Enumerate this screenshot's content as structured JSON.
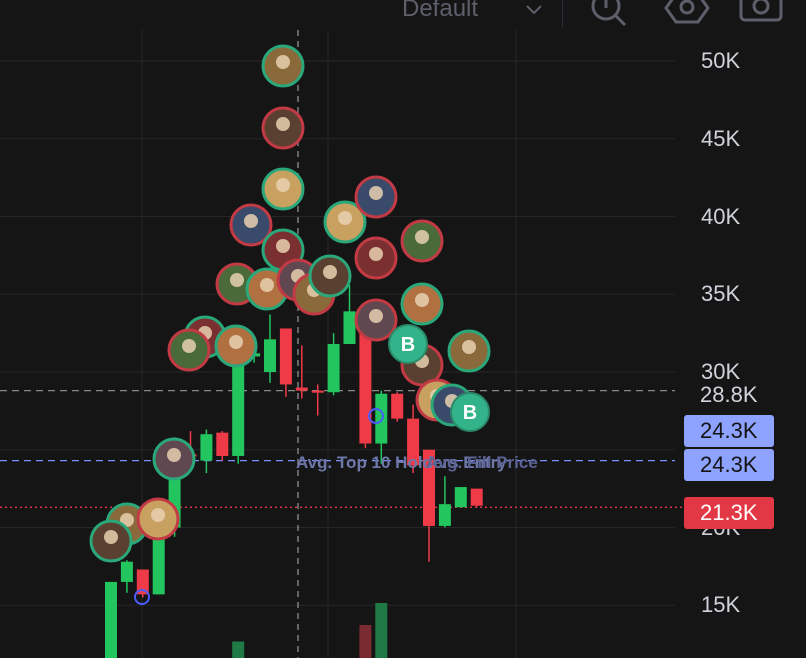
{
  "toolbar": {
    "preset_label": "Default"
  },
  "price_axis": {
    "ticks": [
      "50K",
      "45K",
      "40K",
      "35K",
      "30K",
      "20K",
      "15K"
    ],
    "tags": {
      "top_price": "28.8K",
      "avg_price_1": "24.3K",
      "avg_price_2": "24.3K",
      "current_price": "21.3K"
    }
  },
  "overlay": {
    "label_1": "Avg. Top 10 Holders Entry",
    "label_2": "Avg. Fill Price"
  },
  "markers": {
    "buy_badge": "B"
  },
  "colors": {
    "up": "#22c55e",
    "down": "#ef3b48",
    "avg_line": "#7d8fff",
    "current_line": "#e23845",
    "grid": "#262626"
  },
  "chart_data": {
    "type": "candlestick",
    "title": "",
    "ylabel": "",
    "ylim": [
      13000,
      52000
    ],
    "yticks": [
      15000,
      20000,
      25000,
      30000,
      35000,
      40000,
      45000,
      50000
    ],
    "reference_lines": [
      {
        "name": "top",
        "value": 28800,
        "style": "dashed"
      },
      {
        "name": "avg",
        "value": 24300,
        "style": "dashed"
      },
      {
        "name": "current",
        "value": 21300,
        "style": "dotted"
      }
    ],
    "candles": [
      {
        "o": 11000,
        "h": 16500,
        "l": 11000,
        "c": 16500
      },
      {
        "o": 16500,
        "h": 17900,
        "l": 15800,
        "c": 17800
      },
      {
        "o": 17300,
        "h": 17300,
        "l": 15500,
        "c": 15700
      },
      {
        "o": 15700,
        "h": 20000,
        "l": 15700,
        "c": 20000
      },
      {
        "o": 20000,
        "h": 25800,
        "l": 19400,
        "c": 25400
      },
      {
        "o": 24700,
        "h": 26200,
        "l": 24500,
        "c": 24600
      },
      {
        "o": 24300,
        "h": 26300,
        "l": 23500,
        "c": 26000
      },
      {
        "o": 26100,
        "h": 26200,
        "l": 24300,
        "c": 24600
      },
      {
        "o": 24600,
        "h": 31700,
        "l": 24100,
        "c": 31400
      },
      {
        "o": 31000,
        "h": 31600,
        "l": 30600,
        "c": 31200
      },
      {
        "o": 30000,
        "h": 33700,
        "l": 29300,
        "c": 32100
      },
      {
        "o": 32800,
        "h": 32800,
        "l": 28400,
        "c": 29200
      },
      {
        "o": 29000,
        "h": 31700,
        "l": 28300,
        "c": 28800
      },
      {
        "o": 28800,
        "h": 29200,
        "l": 27200,
        "c": 28700
      },
      {
        "o": 28700,
        "h": 32500,
        "l": 28500,
        "c": 31800
      },
      {
        "o": 31800,
        "h": 35600,
        "l": 31800,
        "c": 33900
      },
      {
        "o": 33900,
        "h": 34200,
        "l": 25100,
        "c": 25400
      },
      {
        "o": 25400,
        "h": 28800,
        "l": 24100,
        "c": 28600
      },
      {
        "o": 28600,
        "h": 28700,
        "l": 26800,
        "c": 27000
      },
      {
        "o": 27000,
        "h": 27900,
        "l": 23500,
        "c": 24000
      },
      {
        "o": 25000,
        "h": 25000,
        "l": 17800,
        "c": 20100
      },
      {
        "o": 20100,
        "h": 23300,
        "l": 20000,
        "c": 21500
      },
      {
        "o": 21300,
        "h": 22600,
        "l": 21300,
        "c": 22600
      },
      {
        "o": 22500,
        "h": 22500,
        "l": 21300,
        "c": 21400
      }
    ],
    "volume_relative": [
      0,
      0,
      0,
      0,
      0,
      0,
      0,
      0,
      0.3,
      0,
      0,
      0,
      0,
      0,
      0,
      0,
      0.6,
      1.0,
      0,
      0,
      0,
      0,
      0,
      0
    ]
  }
}
